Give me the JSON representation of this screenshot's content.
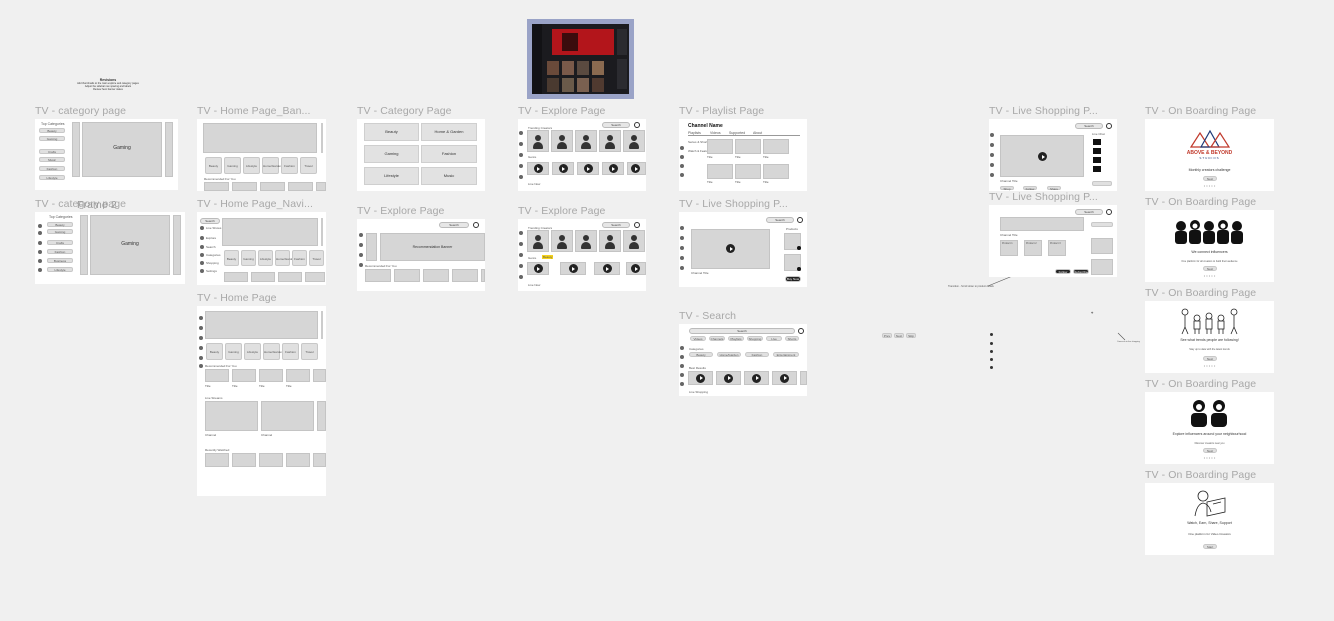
{
  "canvas": {
    "background": "#f0f0f0"
  },
  "note": {
    "title": "Revisions",
    "lines": [
      "Add thumbnails to the main explore and category pages",
      "Adjust the sidebar nav spacing and labels",
      "Review hero banner states"
    ]
  },
  "frames": {
    "cat1": {
      "title": "TV - category page",
      "heading": "Top Categories",
      "hero": "Gaming",
      "items": [
        "Beauty",
        "Gaming",
        "Crafts",
        "Music",
        "Fashion",
        "Lifestyle"
      ]
    },
    "cat2": {
      "title": "TV - category page",
      "overlay": "Frame 2",
      "heading": "Top Categories",
      "hero": "Gaming",
      "items": [
        "Beauty",
        "Gaming",
        "Crafts",
        "Fashion",
        "Business",
        "Lifestyle"
      ]
    },
    "homeBanner": {
      "title": "TV - Home Page_Ban...",
      "chips": [
        "Beauty",
        "Gaming",
        "Lifestyle",
        "Home/Garden",
        "Fashion",
        "Travel"
      ],
      "section": "Recommended For You"
    },
    "homeNav": {
      "title": "TV - Home Page_Navi...",
      "search": "Search",
      "menu": [
        "Live Shows",
        "Explore",
        "Search",
        "Categories",
        "Shopping",
        "Settings"
      ],
      "chips": [
        "Beauty",
        "Gaming",
        "Lifestyle",
        "Home/Garden",
        "Fashion",
        "Travel"
      ]
    },
    "home": {
      "title": "TV - Home Page",
      "chips": [
        "Beauty",
        "Gaming",
        "Lifestyle",
        "Home/Garden",
        "Fashion",
        "Travel"
      ],
      "sections": [
        "Recommended For You",
        "Live Streams",
        "Recently Watched"
      ],
      "card_title": "Title",
      "card_sub": "Channel"
    },
    "catPage": {
      "title": "TV - Category Page",
      "tiles": [
        "Beauty",
        "Home & Garden",
        "Gaming",
        "Fashion",
        "Lifestyle",
        "Music"
      ]
    },
    "explore2": {
      "title": "TV - Explore Page",
      "search": "Search",
      "hero": "Recommendation Banner",
      "section": "Recommended For You"
    },
    "explore1": {
      "title": "TV - Explore Page",
      "search": "Search",
      "row1": "Trending Creators",
      "row2": "Genre",
      "row3": "Live Now"
    },
    "explore3": {
      "title": "TV - Explore Page",
      "search": "Search",
      "row1": "Trending Creators",
      "row2": "Genre",
      "row3": "Live Now",
      "tooltip": "Beauty"
    },
    "playlist": {
      "title": "TV - Playlist Page",
      "channel": "Channel Name",
      "tabs": [
        "Playlists",
        "Videos",
        "Supported",
        "About"
      ],
      "side": [
        "Series & Shorts",
        "Watch & Featured"
      ],
      "card": "Title"
    },
    "liveShop1": {
      "title": "TV - Live Shopping P...",
      "search": "Search",
      "products": "Products",
      "buy": "Buy Now",
      "caption": "Channel Title"
    },
    "search": {
      "title": "TV - Search",
      "search": "Search",
      "filters": [
        "Videos",
        "Channels",
        "Playlists",
        "Shopping",
        "Live",
        "Shorts"
      ],
      "section1": "Categories",
      "pills": [
        "Beauty",
        "Home/Garden",
        "Fashion",
        "Entertainment"
      ],
      "section2": "Best Results",
      "section3": "Live Shopping"
    },
    "liveShop2": {
      "title": "TV - Live Shopping P...",
      "search": "Search",
      "chat": "Live Chat",
      "caption": "Channel Title",
      "buttons": [
        "Shop",
        "Follow",
        "Share"
      ]
    },
    "liveShop3": {
      "title": "TV - Live Shopping P...",
      "search": "Search",
      "caption": "Channel Title",
      "buttons": [
        "Follow",
        "Subscribe"
      ],
      "items": [
        "Product 1",
        "Product 2",
        "Product 3"
      ]
    },
    "onboard1": {
      "title": "TV - On Boarding Page",
      "brand": "ABOVE & BEYOND",
      "brand_sub": "STUDIOS",
      "headline": "Monthly creators challenge",
      "button": "Next"
    },
    "onboard2": {
      "title": "TV - On Boarding Page",
      "headline": "We connect influencers",
      "sub": "One platform for all creators to build their audience",
      "button": "Next"
    },
    "onboard3": {
      "title": "TV - On Boarding Page",
      "headline": "See what trends people are following!",
      "sub": "Stay up to date with the latest trends",
      "button": "Next"
    },
    "onboard4": {
      "title": "TV - On Boarding Page",
      "headline": "Explore influencers around your neighbourhood",
      "sub": "Discover creators near you",
      "button": "Next"
    },
    "onboard5": {
      "title": "TV - On Boarding Page",
      "headline": "Watch, Earn, Share, Support",
      "sub": "One platform for Video Creators",
      "button": "Start"
    }
  },
  "annotations": {
    "connector_note": "Transition - Scroll down to product details",
    "side_note": "Connects to live shopping"
  },
  "controls": [
    "Prev",
    "Next",
    "Skip"
  ]
}
